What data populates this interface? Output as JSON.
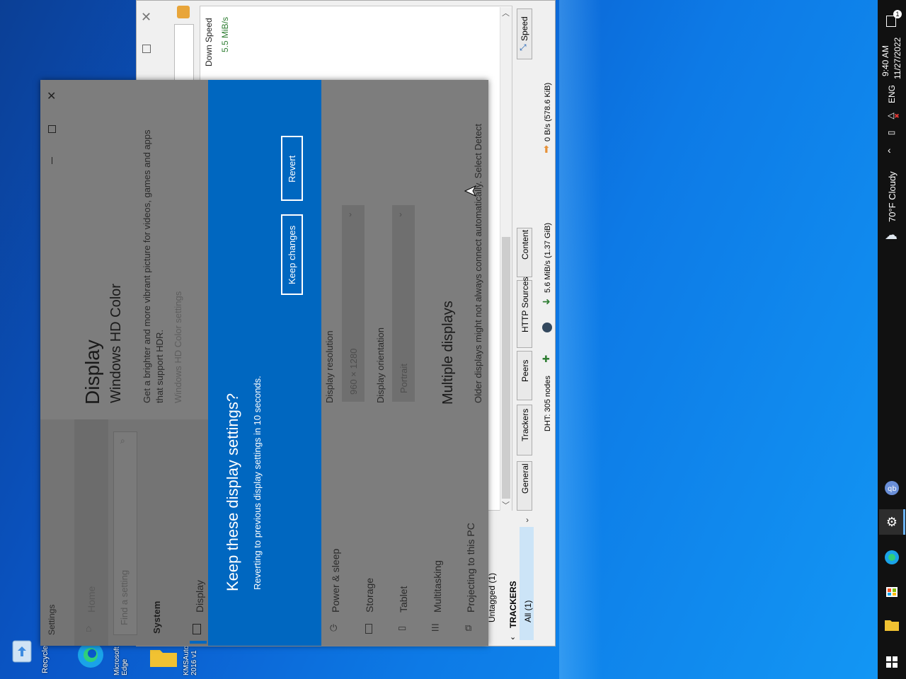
{
  "desktop": {
    "icons": [
      {
        "label": "Recycle Bin"
      },
      {
        "label": "Microsoft Edge"
      },
      {
        "label": "KMSAuto 2016 v1"
      }
    ]
  },
  "taskbar": {
    "time": "9:40 AM",
    "date": "11/27/2022",
    "language": "ENG",
    "weather": "70°F  Cloudy",
    "notification_count": "1"
  },
  "qbittorrent": {
    "graph_label": "Down Speed",
    "graph_value": "5.5 MiB/s",
    "tabs": [
      "General",
      "Trackers",
      "Peers",
      "HTTP Sources",
      "Content",
      "Speed"
    ],
    "sidebar": {
      "untagged": "Untagged (1)",
      "trackers_header": "TRACKERS",
      "all": "All (1)"
    },
    "status": {
      "dht": "DHT: 305 nodes",
      "down": "5.6 MiB/s (1.37 GiB)",
      "up": "0 B/s (578.6 KiB)"
    }
  },
  "settings": {
    "app_title": "Settings",
    "nav": {
      "home": "Home",
      "search_placeholder": "Find a setting",
      "section": "System",
      "items": [
        "Display",
        "Power & sleep",
        "Storage",
        "Tablet",
        "Multitasking",
        "Projecting to this PC"
      ]
    },
    "page_title": "Display",
    "hdr_title": "Windows HD Color",
    "hdr_desc_1": "Get a brighter and more vibrant picture for videos, games and apps",
    "hdr_desc_2": "that support HDR.",
    "hdr_link": "Windows HD Color settings",
    "resolution_label": "Display resolution",
    "resolution_value": "960 × 1280",
    "orientation_label": "Display orientation",
    "orientation_value": "Portrait",
    "multiple_title": "Multiple displays",
    "multiple_desc": "Older displays might not always connect automatically. Select Detect"
  },
  "dialog": {
    "title": "Keep these display settings?",
    "subtitle": "Reverting to previous display settings in 10 seconds.",
    "keep_label": "Keep changes",
    "revert_label": "Revert"
  },
  "colors": {
    "dialog_blue": "#0067c0",
    "settings_dimmed": "#7d7d7d",
    "taskbar": "#111111"
  }
}
